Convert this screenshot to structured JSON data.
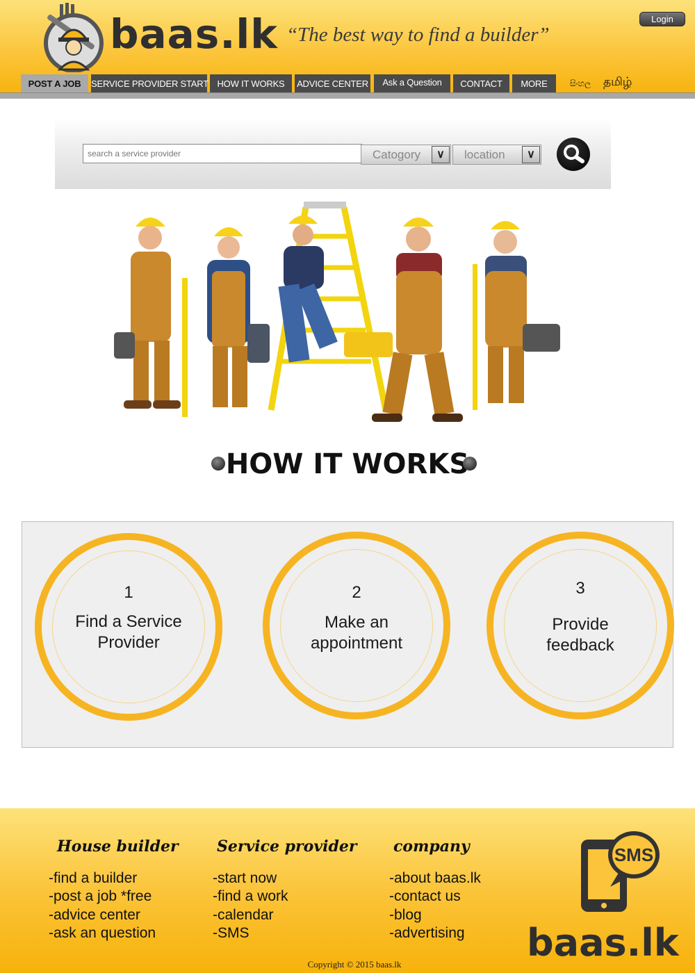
{
  "header": {
    "brand": "baas.lk",
    "tagline": "“The best way to find a builder”",
    "login_label": "Login",
    "nav": [
      {
        "label": "POST A JOB"
      },
      {
        "label": "SERVICE PROVIDER START"
      },
      {
        "label": "HOW IT WORKS"
      },
      {
        "label": "ADVICE CENTER"
      },
      {
        "label": "Ask a Question"
      },
      {
        "label": "CONTACT"
      },
      {
        "label": "MORE"
      }
    ],
    "languages": [
      "සිංහල",
      "தமிழ்"
    ]
  },
  "search": {
    "placeholder": "search a service provider",
    "category_value": "Catogory",
    "location_value": "location"
  },
  "how_it_works": {
    "title": "HOW IT WORKS",
    "steps": [
      {
        "number": "1",
        "line1": "Find a Service",
        "line2": "Provider"
      },
      {
        "number": "2",
        "line1": "Make an",
        "line2": "appointment"
      },
      {
        "number": "3",
        "line1": "Provide",
        "line2": "feedback"
      }
    ]
  },
  "footer": {
    "columns": [
      {
        "title": "House builder",
        "links": [
          "-find a builder",
          "-post a job *free",
          "-advice center",
          "-ask an question"
        ]
      },
      {
        "title": "Service provider",
        "links": [
          "-start now",
          "-find a work",
          "-calendar",
          "-SMS"
        ]
      },
      {
        "title": "company",
        "links": [
          "-about baas.lk",
          "-contact us",
          "-blog",
          "-advertising"
        ]
      }
    ],
    "sms_label": "SMS",
    "brand": "baas.lk",
    "copyright": "Copyright © 2015 baas.lk"
  },
  "colors": {
    "accent": "#f6b422",
    "nav_bg": "#4a4a4a",
    "header_top": "#fde27a",
    "header_bottom": "#f7b20a"
  }
}
